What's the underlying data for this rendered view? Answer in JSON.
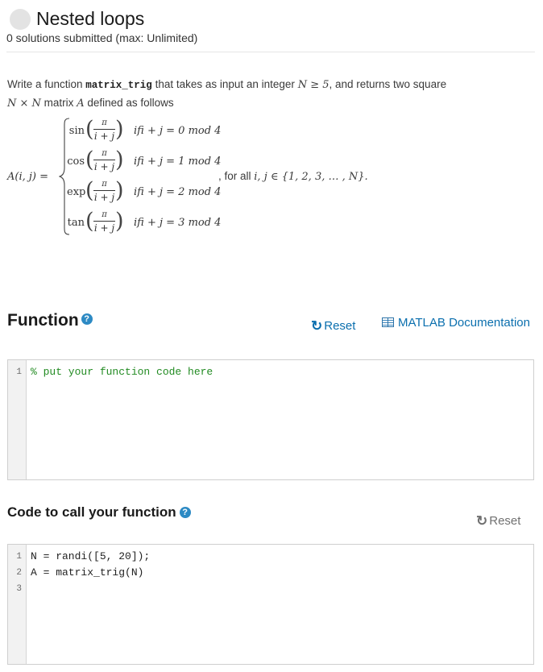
{
  "problem": {
    "title": "Nested loops",
    "submissions": "0 solutions submitted (max: Unlimited)"
  },
  "description": {
    "prefix": "Write a function ",
    "function_name": "matrix_trig",
    "mid": " that takes as input an integer ",
    "cond": "N ≥ 5",
    "suffix": ", and returns two square",
    "line2_dims": "N × N",
    "line2_text": " matrix ",
    "line2_var": "A",
    "line2_end": " defined as follows"
  },
  "formula": {
    "lhs": "A(i, j) =",
    "numerator": "π",
    "denominator": "i + j",
    "cases": [
      {
        "fn": "sin",
        "condition": "ifi + j = 0 mod 4"
      },
      {
        "fn": "cos",
        "condition": "ifi + j = 1 mod 4"
      },
      {
        "fn": "exp",
        "condition": "ifi + j = 2 mod 4"
      },
      {
        "fn": "tan",
        "condition": "ifi + j = 3 mod 4"
      }
    ],
    "forall_text": ", for all ",
    "forall_math": "i, j ∈ {1, 2, 3, … , N}."
  },
  "function_section": {
    "title": "Function",
    "help_icon": "question-circle-icon",
    "reset_label": "Reset",
    "doc_label": "MATLAB Documentation",
    "code_lines": [
      "% put your function code here"
    ],
    "line_numbers": [
      "1"
    ]
  },
  "call_section": {
    "title": "Code to call your function",
    "help_icon": "question-circle-icon",
    "reset_label": "Reset",
    "code_lines": [
      "N = randi([5, 20]);",
      "A = matrix_trig(N)",
      ""
    ],
    "line_numbers": [
      "1",
      "2",
      "3"
    ]
  },
  "colors": {
    "accent": "#0b6fae",
    "help": "#2d8ac4",
    "comment": "#228b22"
  }
}
